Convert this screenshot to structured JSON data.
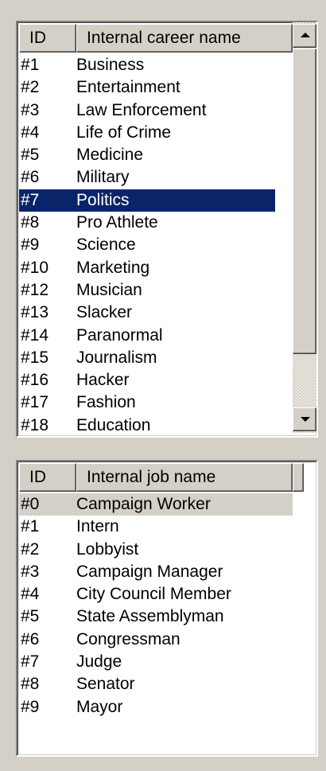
{
  "career_list": {
    "headers": {
      "id": "ID",
      "name": "Internal career name"
    },
    "selected_index": 6,
    "rows": [
      {
        "id": "#1",
        "name": "Business"
      },
      {
        "id": "#2",
        "name": "Entertainment"
      },
      {
        "id": "#3",
        "name": "Law Enforcement"
      },
      {
        "id": "#4",
        "name": "Life of Crime"
      },
      {
        "id": "#5",
        "name": "Medicine"
      },
      {
        "id": "#6",
        "name": "Military"
      },
      {
        "id": "#7",
        "name": "Politics"
      },
      {
        "id": "#8",
        "name": "Pro Athlete"
      },
      {
        "id": "#9",
        "name": "Science"
      },
      {
        "id": "#10",
        "name": "Marketing"
      },
      {
        "id": "#12",
        "name": "Musician"
      },
      {
        "id": "#13",
        "name": "Slacker"
      },
      {
        "id": "#14",
        "name": "Paranormal"
      },
      {
        "id": "#15",
        "name": "Journalism"
      },
      {
        "id": "#16",
        "name": "Hacker"
      },
      {
        "id": "#17",
        "name": "Fashion"
      },
      {
        "id": "#18",
        "name": "Education"
      }
    ],
    "scrollbar": {
      "up_icon": "arrow-up-icon",
      "down_icon": "arrow-down-icon"
    }
  },
  "job_list": {
    "headers": {
      "id": "ID",
      "name": "Internal job name"
    },
    "selected_index": 0,
    "rows": [
      {
        "id": "#0",
        "name": "Campaign Worker"
      },
      {
        "id": "#1",
        "name": "Intern"
      },
      {
        "id": "#2",
        "name": "Lobbyist"
      },
      {
        "id": "#3",
        "name": "Campaign Manager"
      },
      {
        "id": "#4",
        "name": "City Council Member"
      },
      {
        "id": "#5",
        "name": "State Assemblyman"
      },
      {
        "id": "#6",
        "name": "Congressman"
      },
      {
        "id": "#7",
        "name": "Judge"
      },
      {
        "id": "#8",
        "name": "Senator"
      },
      {
        "id": "#9",
        "name": "Mayor"
      }
    ]
  },
  "colors": {
    "window_bg": "#d4d0c8",
    "selection_active": "#0a246a",
    "selection_inactive": "#d4d0c8"
  }
}
